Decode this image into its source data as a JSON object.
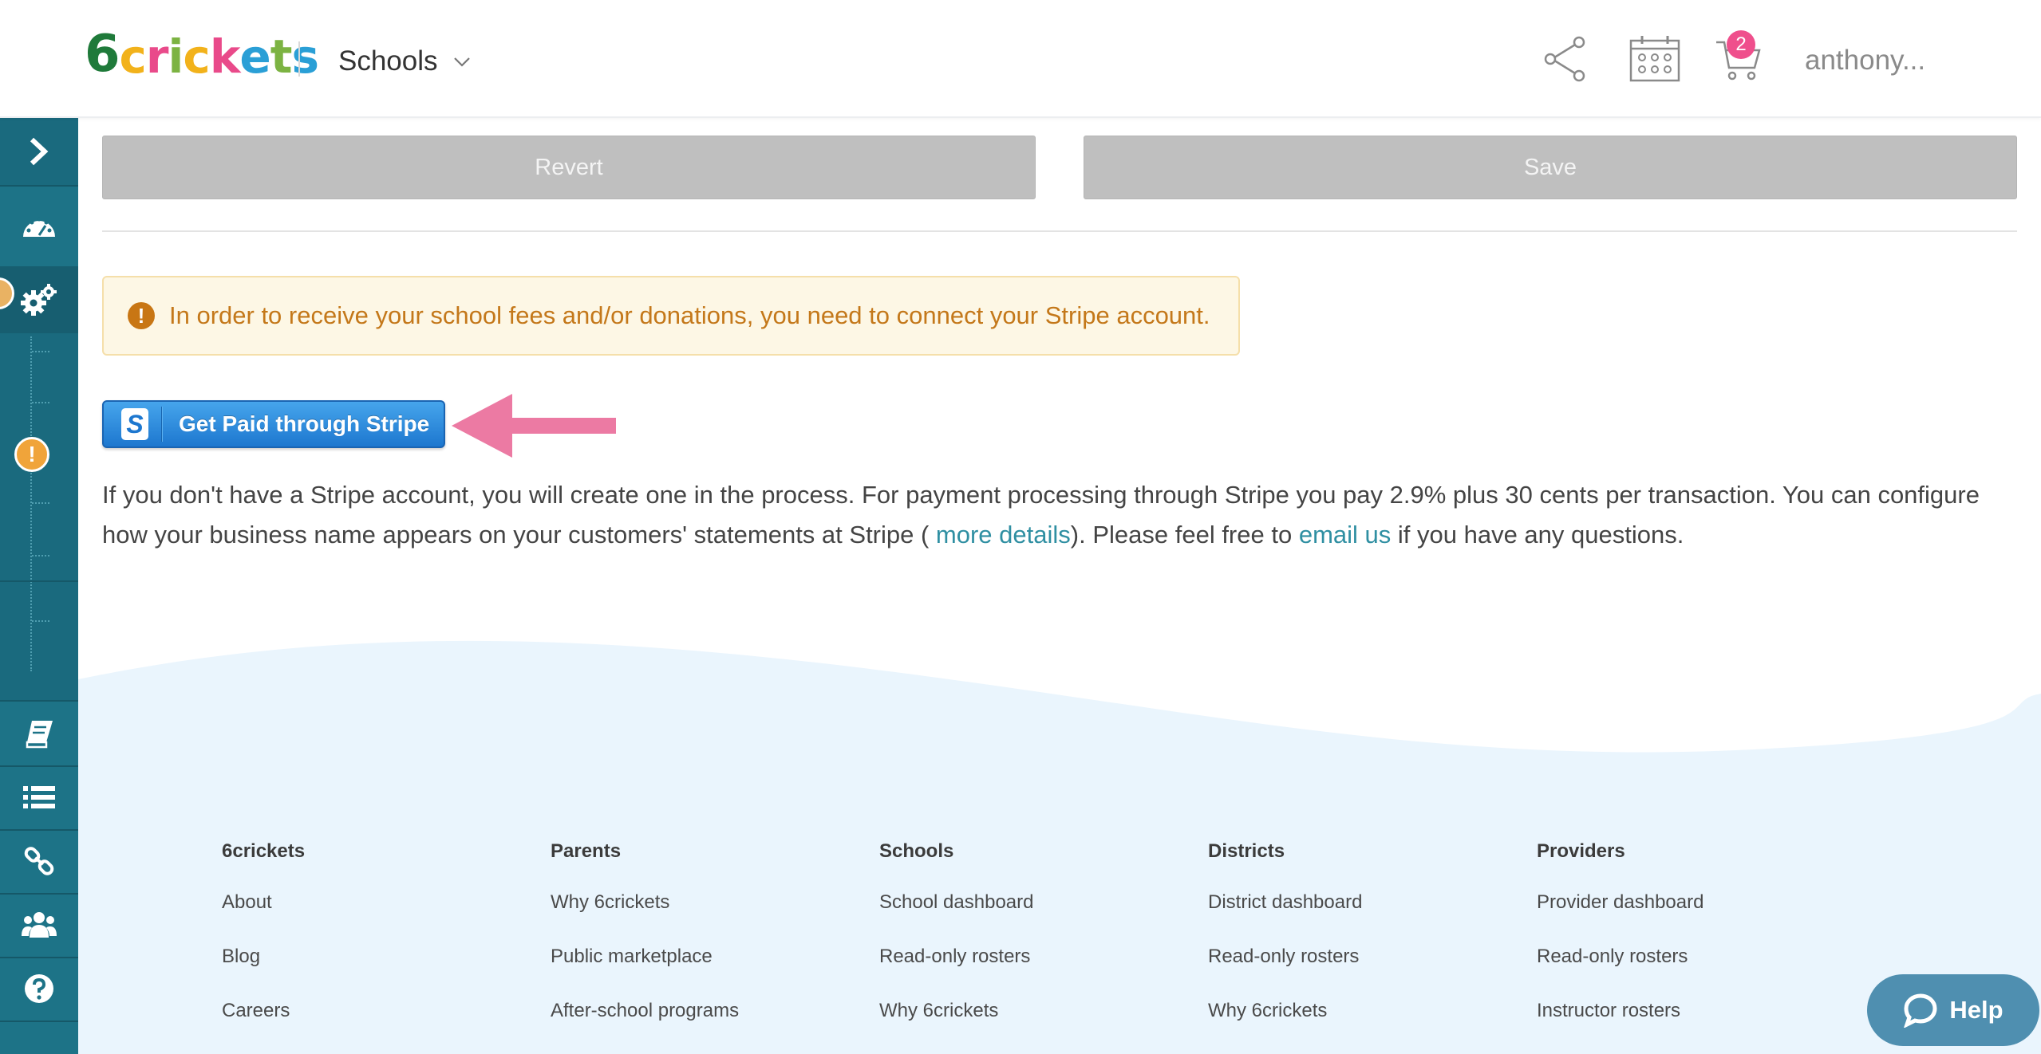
{
  "brand": {
    "logo_letters": [
      {
        "ch": "6",
        "color": "#1f7a3a"
      },
      {
        "ch": "c",
        "color": "#f2b21b"
      },
      {
        "ch": "r",
        "color": "#e94a8a"
      },
      {
        "ch": "i",
        "color": "#7cb342"
      },
      {
        "ch": "c",
        "color": "#f2b21b"
      },
      {
        "ch": "k",
        "color": "#e94a8a"
      },
      {
        "ch": "e",
        "color": "#2a9fd6"
      },
      {
        "ch": "t",
        "color": "#7cb342"
      },
      {
        "ch": "s",
        "color": "#2a9fd6"
      }
    ]
  },
  "header": {
    "context_label": "Schools",
    "cart_count": "2",
    "user_name": "anthony..."
  },
  "actions": {
    "revert_label": "Revert",
    "save_label": "Save"
  },
  "alert": {
    "icon_glyph": "!",
    "text": "In order to receive your school fees and/or donations, you need to connect your Stripe account."
  },
  "stripe": {
    "logo_letter": "S",
    "button_label": "Get Paid through Stripe"
  },
  "info": {
    "text_1": "If you don't have a Stripe account, you will create one in the process. For payment processing through Stripe you pay 2.9% plus 30 cents per transaction. You can configure how your business name appears on your customers' statements at Stripe ( ",
    "link_details": "more details",
    "text_2": "). Please feel free to ",
    "link_email": "email us",
    "text_3": " if you have any questions."
  },
  "footer": {
    "columns": [
      {
        "heading": "6crickets",
        "links": [
          "About",
          "Blog",
          "Careers"
        ]
      },
      {
        "heading": "Parents",
        "links": [
          "Why 6crickets",
          "Public marketplace",
          "After-school programs"
        ]
      },
      {
        "heading": "Schools",
        "links": [
          "School dashboard",
          "Read-only rosters",
          "Why 6crickets"
        ]
      },
      {
        "heading": "Districts",
        "links": [
          "District dashboard",
          "Read-only rosters",
          "Why 6crickets"
        ]
      },
      {
        "heading": "Providers",
        "links": [
          "Provider dashboard",
          "Read-only rosters",
          "Instructor rosters"
        ]
      }
    ]
  },
  "help": {
    "label": "Help"
  },
  "sidebar": {
    "alert_glyph": "!",
    "icons": [
      "chevron-right-icon",
      "dashboard-icon",
      "settings-icon",
      "book-icon",
      "list-icon",
      "link-icon",
      "users-icon",
      "help-icon"
    ]
  },
  "colors": {
    "sidebar": "#1d7387",
    "alert_text": "#c4781a",
    "link": "#2f8fa2",
    "arrow": "#ec7aa3",
    "footer_bg": "#eaf5fd"
  }
}
